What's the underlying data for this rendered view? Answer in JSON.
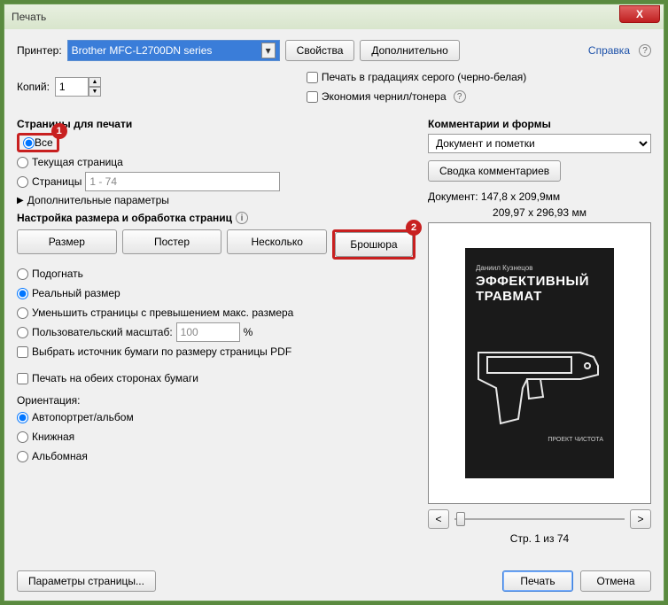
{
  "window": {
    "title": "Печать",
    "close": "X"
  },
  "help_link": "Справка",
  "printer": {
    "label": "Принтер:",
    "selected": "Brother MFC-L2700DN series",
    "properties_btn": "Свойства",
    "advanced_btn": "Дополнительно"
  },
  "copies": {
    "label": "Копий:",
    "value": "1"
  },
  "options": {
    "grayscale": "Печать в градациях серого (черно-белая)",
    "save_ink": "Экономия чернил/тонера"
  },
  "pages_section": {
    "title": "Страницы для печати",
    "all": "Все",
    "current": "Текущая страница",
    "range_label": "Страницы",
    "range_value": "1 - 74",
    "more": "Дополнительные параметры"
  },
  "annot": {
    "one": "1",
    "two": "2"
  },
  "size_section": {
    "title": "Настройка размера и обработка страниц",
    "tabs": {
      "size": "Размер",
      "poster": "Постер",
      "multiple": "Несколько",
      "booklet": "Брошюра"
    },
    "fit": "Подогнать",
    "actual": "Реальный размер",
    "shrink": "Уменьшить страницы с превышением макс. размера",
    "custom_label": "Пользовательский масштаб:",
    "custom_value": "100",
    "custom_unit": "%",
    "choose_source": "Выбрать источник бумаги по размеру страницы PDF",
    "duplex": "Печать на обеих сторонах бумаги",
    "orientation_label": "Ориентация:",
    "orientation": {
      "auto": "Автопортрет/альбом",
      "portrait": "Книжная",
      "landscape": "Альбомная"
    }
  },
  "comments": {
    "title": "Комментарии и формы",
    "selected": "Документ и пометки",
    "summary_btn": "Сводка комментариев"
  },
  "preview": {
    "doc_size": "Документ: 147,8 x 209,9мм",
    "paper_size": "209,97 x 296,93 мм",
    "author": "Даниил Кузнецов",
    "line1": "ЭФФЕКТИВНЫЙ",
    "line2": "ТРАВМАТ",
    "project": "ПРОЕКТ ЧИСТОТА",
    "nav_prev": "<",
    "nav_next": ">",
    "page_status": "Стр. 1 из 74"
  },
  "footer": {
    "page_setup": "Параметры страницы...",
    "print": "Печать",
    "cancel": "Отмена"
  }
}
